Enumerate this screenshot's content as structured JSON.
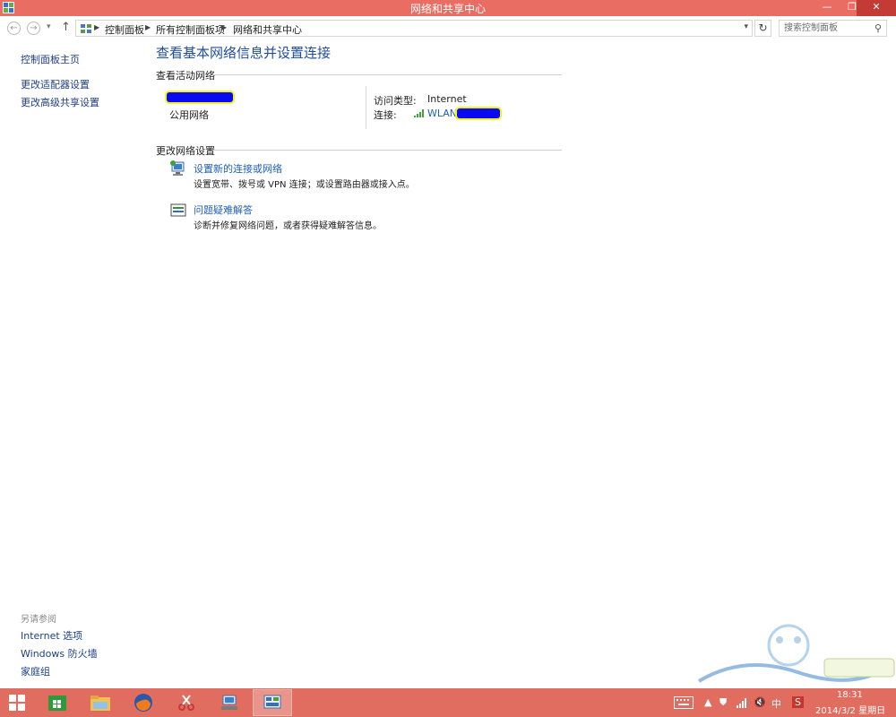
{
  "window": {
    "title": "网络和共享中心",
    "controls": {
      "minimize": "—",
      "restore": "❐",
      "close": "✕"
    }
  },
  "address_bar": {
    "breadcrumbs": [
      "控制面板",
      "所有控制面板项",
      "网络和共享中心"
    ],
    "search_placeholder": "搜索控制面板"
  },
  "left_pane": {
    "links": [
      "控制面板主页",
      "更改适配器设置",
      "更改高级共享设置"
    ],
    "see_also_label": "另请参阅",
    "see_also_links": [
      "Internet 选项",
      "Windows 防火墙",
      "家庭组"
    ]
  },
  "main": {
    "title": "查看基本网络信息并设置连接",
    "active_networks_heading": "查看活动网络",
    "network": {
      "category": "公用网络",
      "access_type_label": "访问类型:",
      "access_type_value": "Internet",
      "connection_label": "连接:",
      "connection_value": "WLAN"
    },
    "change_settings_heading": "更改网络设置",
    "tasks": [
      {
        "link": "设置新的连接或网络",
        "description": "设置宽带、拨号或 VPN 连接；或设置路由器或接入点。"
      },
      {
        "link": "问题疑难解答",
        "description": "诊断并修复网络问题，或者获得疑难解答信息。"
      }
    ]
  },
  "taskbar": {
    "tray_ime": "中",
    "clock_time": "18:31",
    "clock_date": "2014/3/2 星期日"
  },
  "colors": {
    "accent": "#e96d63",
    "link": "#1f5fb8",
    "title_blue": "#1f4e9e"
  }
}
